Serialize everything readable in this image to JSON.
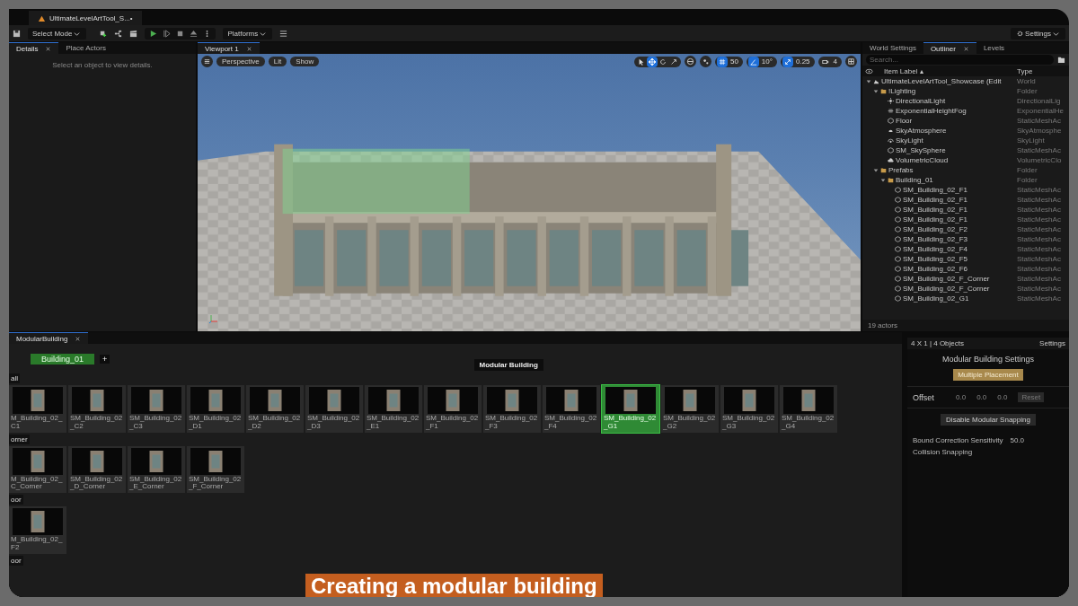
{
  "title_tab": {
    "label": "UltimateLevelArtTool_S...•"
  },
  "toolbar": {
    "mode": "Select Mode",
    "platforms": "Platforms",
    "settings": "Settings"
  },
  "left_tabs": [
    {
      "label": "Details",
      "selected": true
    },
    {
      "label": "Place Actors",
      "selected": false
    }
  ],
  "details_hint": "Select an object to view details.",
  "viewport": {
    "tab": "Viewport 1",
    "view_buttons": [
      "Perspective",
      "Lit",
      "Show"
    ],
    "snap_tools": [
      {
        "kind": "select",
        "selected": false
      },
      {
        "kind": "move",
        "selected": true
      },
      {
        "kind": "rotate",
        "selected": false
      },
      {
        "kind": "scale",
        "selected": false
      }
    ],
    "toggles": [
      {
        "kind": "grid",
        "value": "50",
        "on": true
      },
      {
        "kind": "angle",
        "value": "10°",
        "on": true
      },
      {
        "kind": "scale",
        "value": "0.25",
        "on": true
      },
      {
        "kind": "camera",
        "value": "4",
        "on": false
      }
    ]
  },
  "right_tabs": [
    {
      "label": "World Settings",
      "selected": false
    },
    {
      "label": "Outliner",
      "selected": true
    },
    {
      "label": "Levels",
      "selected": false
    }
  ],
  "outliner": {
    "search_placeholder": "Search...",
    "columns": [
      "Item Label ▴",
      "Type"
    ],
    "items": [
      {
        "label": "UltimateLevelArtTool_Showcase (Edit",
        "type": "World",
        "kind": "world",
        "children": [
          {
            "label": "!Lighting",
            "type": "Folder",
            "kind": "folder",
            "children": [
              {
                "label": "DirectionalLight",
                "type": "DirectionalLig",
                "kind": "light"
              },
              {
                "label": "ExponentialHeightFog",
                "type": "ExponentialHe",
                "kind": "fog"
              },
              {
                "label": "Floor",
                "type": "StaticMeshAc",
                "kind": "mesh"
              },
              {
                "label": "SkyAtmosphere",
                "type": "SkyAtmosphe",
                "kind": "atmosphere"
              },
              {
                "label": "SkyLight",
                "type": "SkyLight",
                "kind": "skylight"
              },
              {
                "label": "SM_SkySphere",
                "type": "StaticMeshAc",
                "kind": "mesh"
              },
              {
                "label": "VolumetricCloud",
                "type": "VolumetricClo",
                "kind": "cloud"
              }
            ]
          },
          {
            "label": "Prefabs",
            "type": "Folder",
            "kind": "folder",
            "children": [
              {
                "label": "Building_01",
                "type": "Folder",
                "kind": "folder",
                "children": [
                  {
                    "label": "SM_Building_02_F1",
                    "type": "StaticMeshAc",
                    "kind": "mesh"
                  },
                  {
                    "label": "SM_Building_02_F1",
                    "type": "StaticMeshAc",
                    "kind": "mesh"
                  },
                  {
                    "label": "SM_Building_02_F1",
                    "type": "StaticMeshAc",
                    "kind": "mesh"
                  },
                  {
                    "label": "SM_Building_02_F1",
                    "type": "StaticMeshAc",
                    "kind": "mesh"
                  },
                  {
                    "label": "SM_Building_02_F2",
                    "type": "StaticMeshAc",
                    "kind": "mesh"
                  },
                  {
                    "label": "SM_Building_02_F3",
                    "type": "StaticMeshAc",
                    "kind": "mesh"
                  },
                  {
                    "label": "SM_Building_02_F4",
                    "type": "StaticMeshAc",
                    "kind": "mesh"
                  },
                  {
                    "label": "SM_Building_02_F5",
                    "type": "StaticMeshAc",
                    "kind": "mesh"
                  },
                  {
                    "label": "SM_Building_02_F6",
                    "type": "StaticMeshAc",
                    "kind": "mesh"
                  },
                  {
                    "label": "SM_Building_02_F_Corner",
                    "type": "StaticMeshAc",
                    "kind": "mesh"
                  },
                  {
                    "label": "SM_Building_02_F_Corner",
                    "type": "StaticMeshAc",
                    "kind": "mesh"
                  },
                  {
                    "label": "SM_Building_02_G1",
                    "type": "StaticMeshAc",
                    "kind": "mesh"
                  }
                ]
              }
            ]
          }
        ]
      }
    ],
    "status": "19 actors"
  },
  "modular": {
    "tab": "ModularBuilding",
    "building": "Building_01",
    "add": "+",
    "heading": "Modular Building",
    "sections": [
      {
        "title": "all",
        "items": [
          {
            "label": "M_Building_02_C1",
            "selected": false
          },
          {
            "label": "SM_Building_02_C2",
            "selected": false
          },
          {
            "label": "SM_Building_02_C3",
            "selected": false
          },
          {
            "label": "SM_Building_02_D1",
            "selected": false
          },
          {
            "label": "SM_Building_02_D2",
            "selected": false
          },
          {
            "label": "SM_Building_02_D3",
            "selected": false
          },
          {
            "label": "SM_Building_02_E1",
            "selected": false
          },
          {
            "label": "SM_Building_02_F1",
            "selected": false
          },
          {
            "label": "SM_Building_02_F3",
            "selected": false
          },
          {
            "label": "SM_Building_02_F4",
            "selected": false
          },
          {
            "label": "SM_Building_02_G1",
            "selected": true
          },
          {
            "label": "SM_Building_02_G2",
            "selected": false
          },
          {
            "label": "SM_Building_02_G3",
            "selected": false
          },
          {
            "label": "SM_Building_02_G4",
            "selected": false
          }
        ]
      },
      {
        "title": "orner",
        "items": [
          {
            "label": "M_Building_02_C_Corner",
            "selected": false
          },
          {
            "label": "SM_Building_02_D_Corner",
            "selected": false
          },
          {
            "label": "SM_Building_02_E_Corner",
            "selected": false
          },
          {
            "label": "SM_Building_02_F_Corner",
            "selected": false
          }
        ]
      },
      {
        "title": "oor",
        "items": [
          {
            "label": "M_Building_02_F2",
            "selected": false
          }
        ]
      },
      {
        "title": "oor"
      }
    ]
  },
  "settings_panel": {
    "summary": "4 X 1 | 4 Objects",
    "settings": "Settings",
    "title": "Modular Building Settings",
    "placement": "Multiple Placement",
    "offset_label": "Offset",
    "offsets": [
      "0.0",
      "0.0",
      "0.0"
    ],
    "reset": "Reset",
    "snapping": "Disable Modular Snapping",
    "sensitivity_label": "Bound Correction Sensitivity",
    "sensitivity": "50.0",
    "collision": "Collision Snapping"
  },
  "caption": "Creating a modular building"
}
